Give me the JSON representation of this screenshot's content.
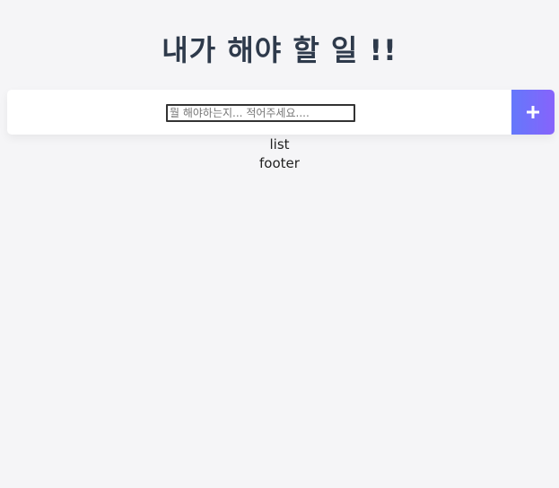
{
  "header": {
    "title": "내가 해야 할 일 !!"
  },
  "todo_input": {
    "placeholder": "뭘 해야하는지... 적어주세요....",
    "value": ""
  },
  "add_button": {
    "icon": "plus-icon",
    "gradient_start": "#6478fb",
    "gradient_end": "#8763fb"
  },
  "list": {
    "label": "list"
  },
  "footer": {
    "label": "footer"
  },
  "colors": {
    "background": "#f5f5f7",
    "title": "#2e3a4b"
  }
}
